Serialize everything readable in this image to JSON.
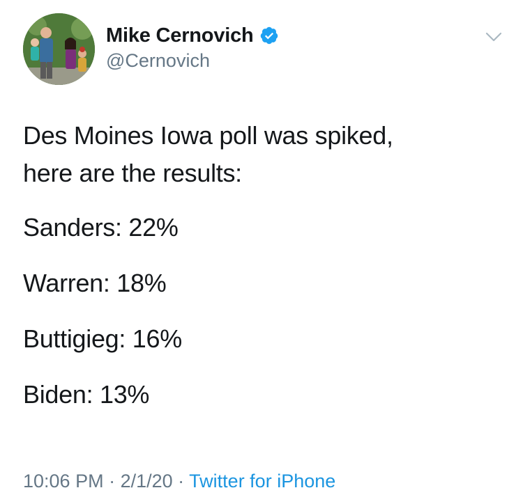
{
  "author": {
    "display_name": "Mike Cernovich",
    "handle": "@Cernovich",
    "verified": true,
    "avatar_icon": "family-photo-avatar",
    "verified_icon": "verified-badge-icon"
  },
  "menu": {
    "icon": "chevron-down-icon"
  },
  "tweet": {
    "lines": [
      "Des Moines Iowa poll was spiked,",
      "here are the results:"
    ],
    "results": [
      "Sanders: 22%",
      "Warren: 18%",
      "Buttigieg: 16%",
      "Biden: 13%"
    ]
  },
  "meta": {
    "time": "10:06 PM",
    "date": "2/1/20",
    "source": "Twitter for iPhone",
    "separator": " · "
  },
  "colors": {
    "text": "#14171a",
    "secondary": "#657786",
    "accent": "#1b95e0",
    "verified": "#1da1f2"
  }
}
